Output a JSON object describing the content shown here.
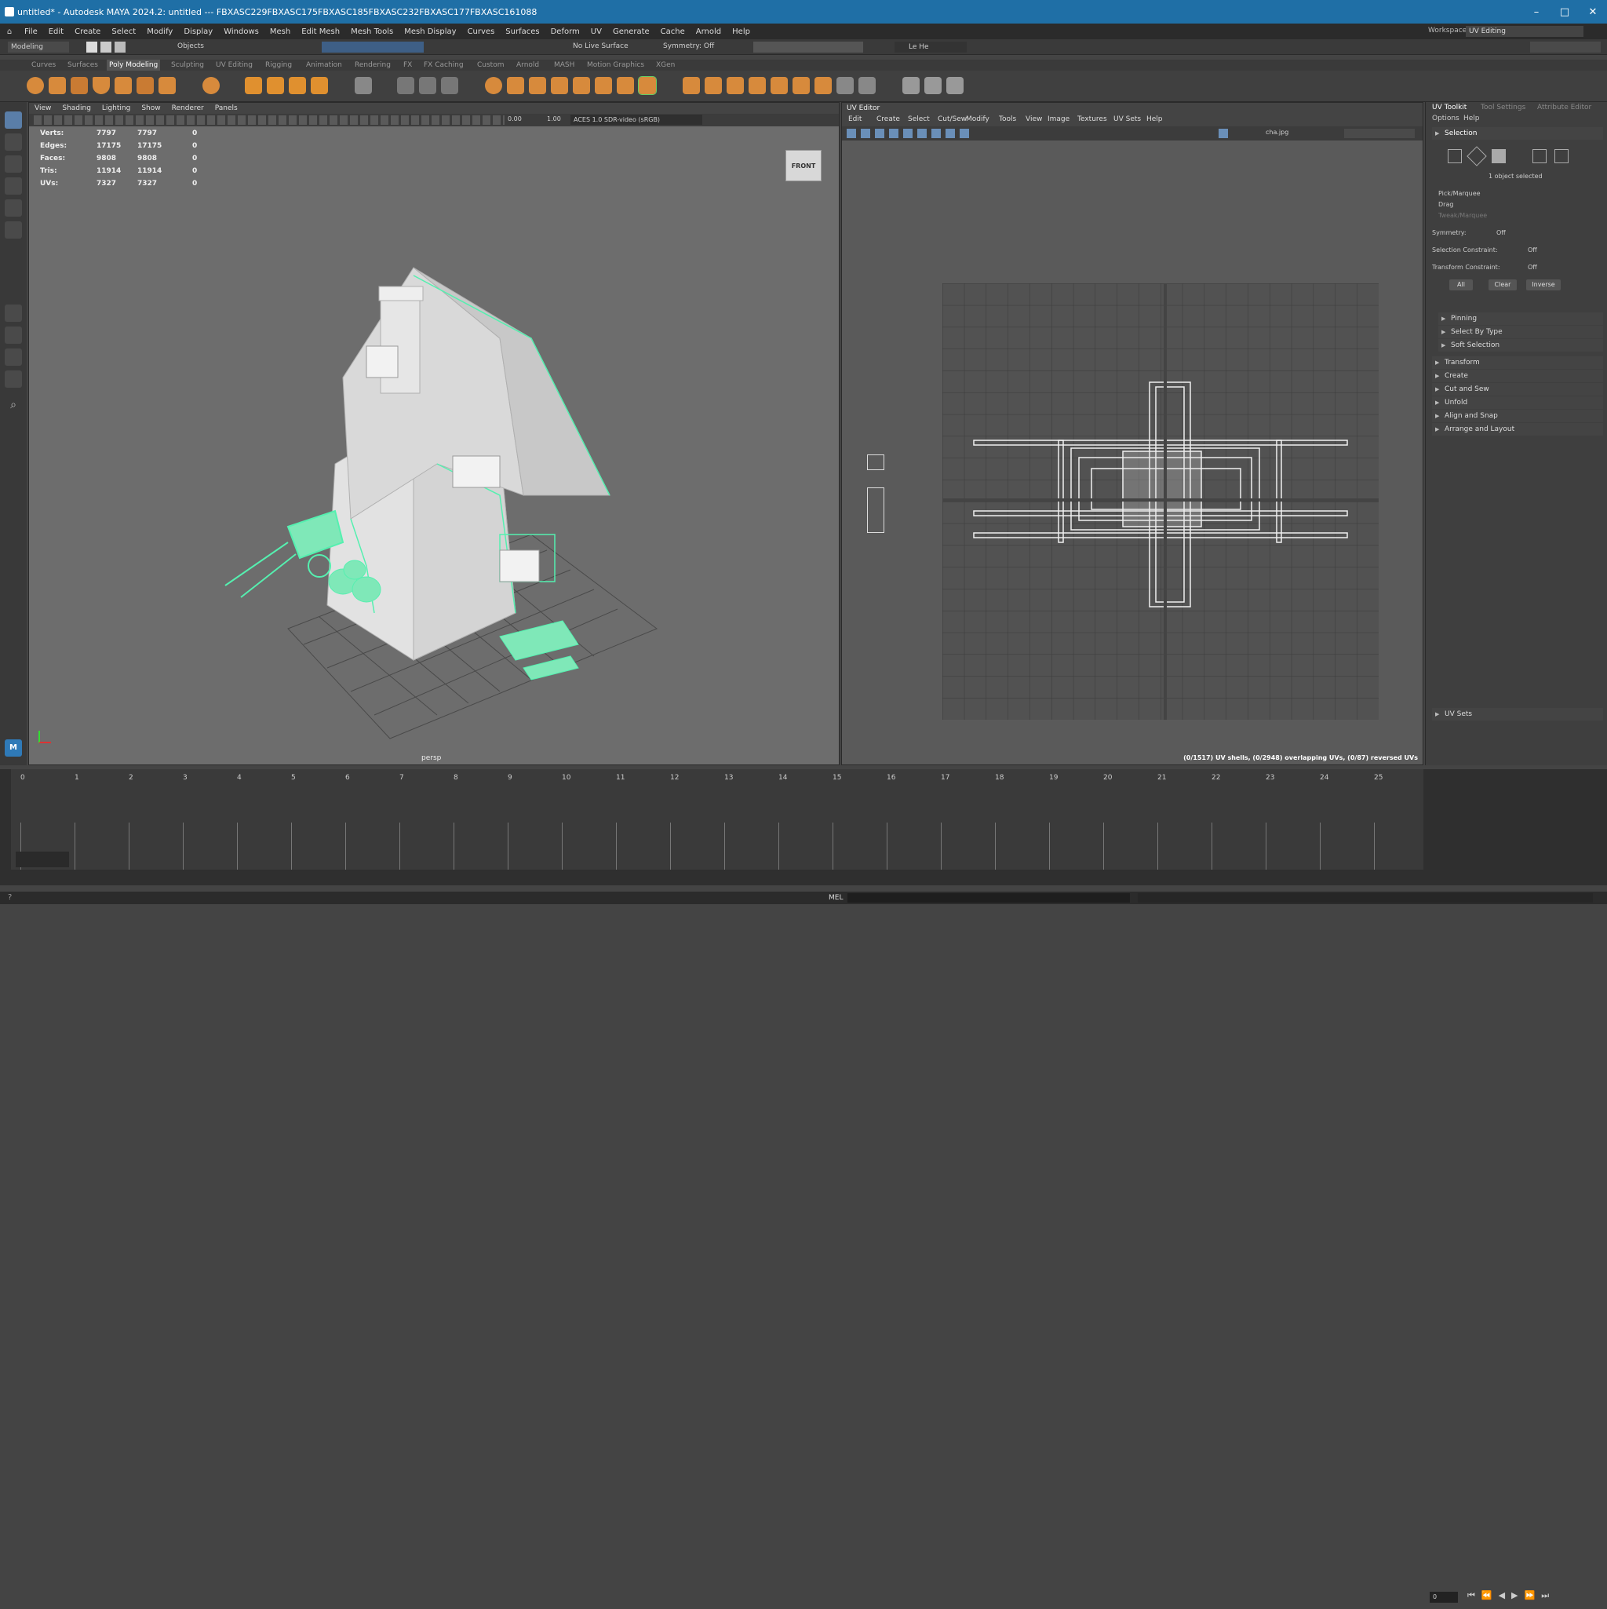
{
  "title_bar": {
    "text": "untitled* - Autodesk MAYA 2024.2: untitled  ---  FBXASC229FBXASC175FBXASC185FBXASC232FBXASC177FBXASC161088"
  },
  "menu": [
    "File",
    "Edit",
    "Create",
    "Select",
    "Modify",
    "Display",
    "Windows",
    "Mesh",
    "Edit Mesh",
    "Mesh Tools",
    "Mesh Display",
    "Curves",
    "Surfaces",
    "Deform",
    "UV",
    "Generate",
    "Cache",
    "Arnold",
    "Help"
  ],
  "workspace": {
    "label": "Workspace:",
    "value": "UV Editing"
  },
  "status_line": {
    "mode": "Modeling",
    "objects": "Objects",
    "live_surface": "No Live Surface",
    "symmetry": "Symmetry: Off",
    "user": "Le He"
  },
  "shelf_tabs": [
    "Curves",
    "Surfaces",
    "Poly Modeling",
    "Sculpting",
    "UV Editing",
    "Rigging",
    "Animation",
    "Rendering",
    "FX",
    "FX Caching",
    "Custom",
    "Arnold",
    "MASH",
    "Motion Graphics",
    "XGen"
  ],
  "viewport": {
    "menu": [
      "View",
      "Shading",
      "Lighting",
      "Show",
      "Renderer",
      "Panels"
    ],
    "exposure": "0.00",
    "gamma": "1.00",
    "color_space": "ACES 1.0 SDR-video (sRGB)",
    "camera": "persp",
    "view_cube": "FRONT",
    "hud": [
      {
        "label": "Verts:",
        "a": "7797",
        "b": "7797",
        "c": "0"
      },
      {
        "label": "Edges:",
        "a": "17175",
        "b": "17175",
        "c": "0"
      },
      {
        "label": "Faces:",
        "a": "9808",
        "b": "9808",
        "c": "0"
      },
      {
        "label": "Tris:",
        "a": "11914",
        "b": "11914",
        "c": "0"
      },
      {
        "label": "UVs:",
        "a": "7327",
        "b": "7327",
        "c": "0"
      }
    ]
  },
  "uv_editor": {
    "title": "UV Editor",
    "menu": [
      "Edit",
      "Create",
      "Select",
      "Cut/Sew",
      "Modify",
      "Tools",
      "View",
      "Image",
      "Textures",
      "UV Sets",
      "Help"
    ],
    "image": "cha.jpg",
    "status": "(0/1517) UV shells, (0/2948) overlapping UVs, (0/87) reversed UVs"
  },
  "right_panel": {
    "tabs": [
      "UV Toolkit",
      "Tool Settings",
      "Attribute Editor"
    ],
    "menu": [
      "Options",
      "Help"
    ],
    "selection_header": "Selection",
    "selected_text": "1 object selected",
    "pick_modes": [
      "Pick/Marquee",
      "Drag",
      "Tweak/Marquee"
    ],
    "symmetry": {
      "label": "Symmetry:",
      "value": "Off"
    },
    "sel_constraint": {
      "label": "Selection Constraint:",
      "value": "Off"
    },
    "xform_constraint": {
      "label": "Transform Constraint:",
      "value": "Off"
    },
    "buttons": [
      "All",
      "Clear",
      "Inverse"
    ],
    "sub_sections": [
      "Pinning",
      "Select By Type",
      "Soft Selection"
    ],
    "sections": [
      "Transform",
      "Create",
      "Cut and Sew",
      "Unfold",
      "Align and Snap",
      "Arrange and Layout"
    ],
    "uv_sets": "UV Sets"
  },
  "timeline": {
    "frames": [
      "0",
      "1",
      "2",
      "3",
      "4",
      "5",
      "6",
      "7",
      "8",
      "9",
      "10",
      "11",
      "12",
      "13",
      "14",
      "15",
      "16",
      "17",
      "18",
      "19",
      "20",
      "21",
      "22",
      "23",
      "24",
      "25"
    ],
    "current": "0",
    "start": "0"
  },
  "command_line": {
    "label": "MEL"
  },
  "colors": {
    "titlebar": "#1f6fa6",
    "wire": "#55f0b0",
    "accent": "#d78a3c"
  }
}
